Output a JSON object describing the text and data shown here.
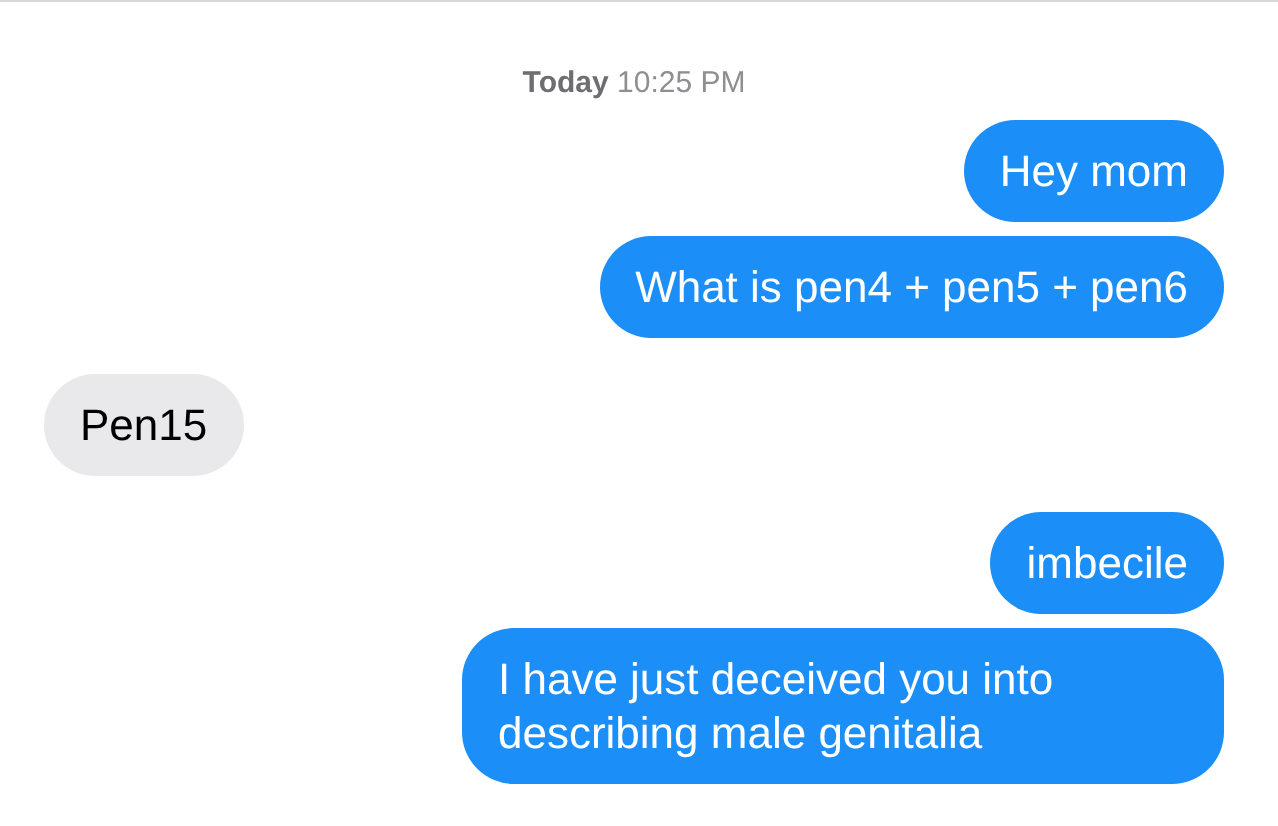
{
  "timestamp": "**Today** 10:25 PM",
  "messages": [
    {
      "kind": "sent",
      "text": "Hey mom"
    },
    {
      "kind": "sent",
      "text": "What is pen4 + pen5 + pen6"
    },
    {
      "kind": "received",
      "text": "Pen15"
    },
    {
      "kind": "sent",
      "text": "imbecile"
    },
    {
      "kind": "sent",
      "text": "I have just deceived you into describing male genitalia"
    }
  ]
}
